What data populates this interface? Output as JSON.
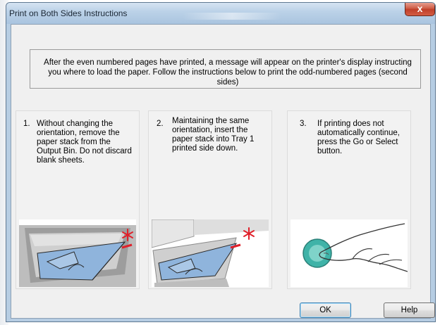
{
  "window": {
    "title": "Print on Both Sides Instructions",
    "close_glyph": "x"
  },
  "intro": {
    "text": "After the even numbered pages have printed, a message will appear on the printer's display instructing you where to load the paper. Follow the instructions below to print the odd-numbered pages (second sides)"
  },
  "steps": [
    {
      "number": "1.",
      "text": "Without changing the orientation, remove the paper stack from the Output Bin.  Do not discard blank sheets.",
      "image_icon": "output-bin-paper-illustration"
    },
    {
      "number": "2.",
      "text": "Maintaining the same orientation, insert the paper stack into Tray 1 printed side down.",
      "image_icon": "tray1-paper-illustration"
    },
    {
      "number": "3.",
      "text": "If printing does not automatically continue, press the Go or Select button.",
      "image_icon": "press-button-illustration"
    }
  ],
  "buttons": {
    "ok_label": "OK",
    "help_label": "Help"
  },
  "colors": {
    "title_bar": "#bcd2e8",
    "close_button": "#c8472f",
    "dialog_body": "#f0f0f0",
    "marker_red": "#e0202a",
    "paper_blue": "#8fb4dc",
    "button_teal": "#3fb3a8"
  }
}
